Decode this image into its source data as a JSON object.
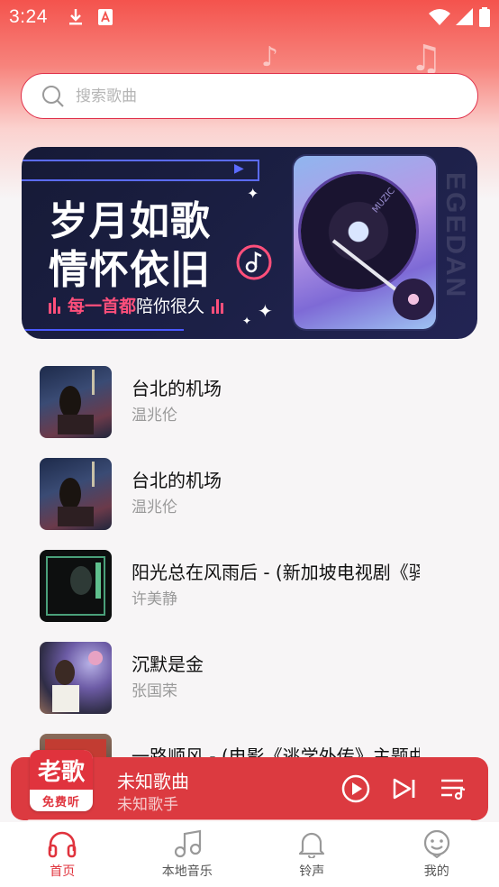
{
  "status_bar": {
    "time": "3:24",
    "left_icons": [
      "download-icon",
      "a-icon"
    ],
    "right_icons": [
      "wifi-icon",
      "signal-icon",
      "battery-icon"
    ]
  },
  "search": {
    "placeholder": "搜索歌曲",
    "value": ""
  },
  "banner": {
    "line1": "岁月如歌",
    "line2": "情怀依旧",
    "tagline_highlight": "每一首都",
    "tagline_rest": "陪你很久",
    "side_text": "EGEDAN",
    "disc_text": "MUZIC"
  },
  "songs": [
    {
      "title": "台北的机场",
      "artist": "温兆伦"
    },
    {
      "title": "台北的机场",
      "artist": "温兆伦"
    },
    {
      "title": "阳光总在风雨后 - (新加坡电视剧《驿",
      "artist": "许美静"
    },
    {
      "title": "沉默是金",
      "artist": "张国荣"
    },
    {
      "title": "一路顺风 - (电影《逃学外传》主题曲",
      "artist": ""
    }
  ],
  "player": {
    "logo_top": "老歌",
    "logo_bottom": "免费听",
    "title": "未知歌曲",
    "artist": "未知歌手"
  },
  "nav": [
    {
      "label": "首页",
      "icon": "headphones-icon",
      "active": true
    },
    {
      "label": "本地音乐",
      "icon": "music-note-icon",
      "active": false
    },
    {
      "label": "铃声",
      "icon": "bell-icon",
      "active": false
    },
    {
      "label": "我的",
      "icon": "smiley-face-icon",
      "active": false
    }
  ],
  "colors": {
    "accent": "#e0333d",
    "player_bg": "#dc3a40",
    "header_gradient_top": "#f4534d"
  }
}
